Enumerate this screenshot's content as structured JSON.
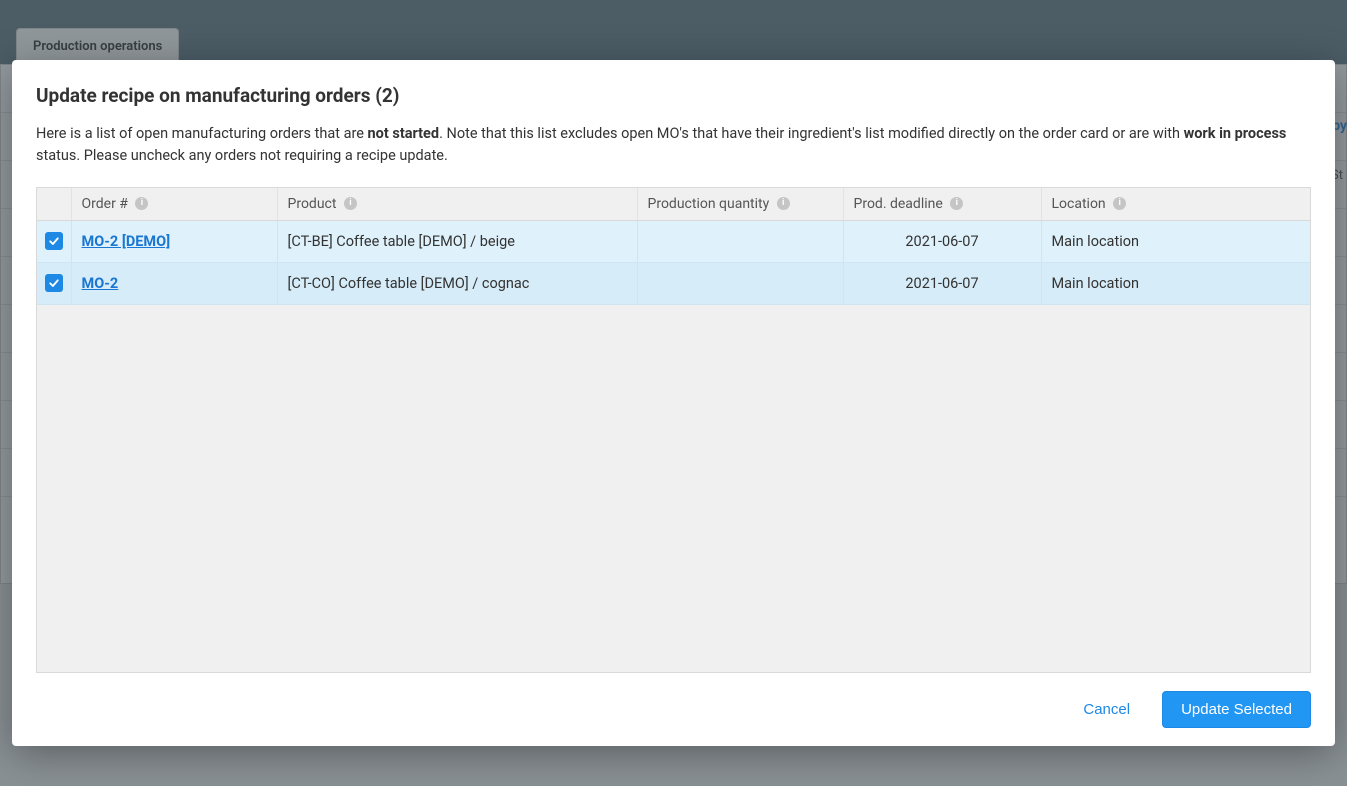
{
  "background": {
    "tab_label": "Production operations",
    "right_link_partial": "py",
    "right_col_partial": "St"
  },
  "modal": {
    "title": "Update recipe on manufacturing orders (2)",
    "desc_p1": "Here is a list of open manufacturing orders that are ",
    "desc_b1": "not started",
    "desc_p2": ". Note that this list excludes open MO's that have their ingredient's list modified directly on the order card or are with ",
    "desc_b2": "work in process",
    "desc_p3": " status. Please uncheck any orders not requiring a recipe update.",
    "columns": {
      "order": "Order #",
      "product": "Product",
      "qty": "Production quantity",
      "deadline": "Prod. deadline",
      "location": "Location"
    },
    "rows": [
      {
        "checked": true,
        "order": "MO-2 [DEMO]",
        "product": "[CT-BE] Coffee table [DEMO] / beige",
        "qty": "",
        "deadline": "2021-06-07",
        "location": "Main location"
      },
      {
        "checked": true,
        "order": "MO-2",
        "product": "[CT-CO] Coffee table [DEMO] / cognac",
        "qty": "",
        "deadline": "2021-06-07",
        "location": "Main location"
      }
    ],
    "buttons": {
      "cancel": "Cancel",
      "update": "Update Selected"
    }
  }
}
